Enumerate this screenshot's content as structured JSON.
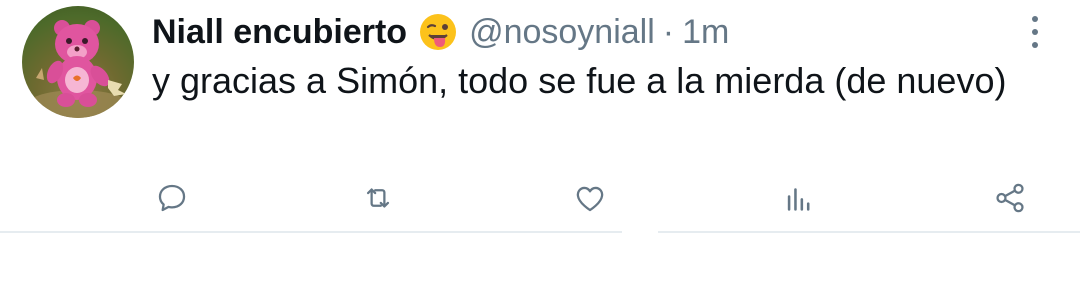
{
  "tweet": {
    "display_name": "Niall encubierto",
    "emoji": "😜",
    "handle": "@nosoyniall",
    "separator": "·",
    "time": "1m",
    "text": "y gracias a Simón, todo se fue a la mierda (de nuevo)"
  },
  "icons": {
    "avatar": "pink-care-bear-avatar",
    "more": "more-vertical-icon",
    "reply": "reply-icon",
    "retweet": "retweet-icon",
    "like": "heart-icon",
    "analytics": "analytics-icon",
    "share": "share-icon"
  },
  "colors": {
    "text": "#0f1419",
    "secondary": "#657786",
    "divider": "#e6ecf0"
  }
}
